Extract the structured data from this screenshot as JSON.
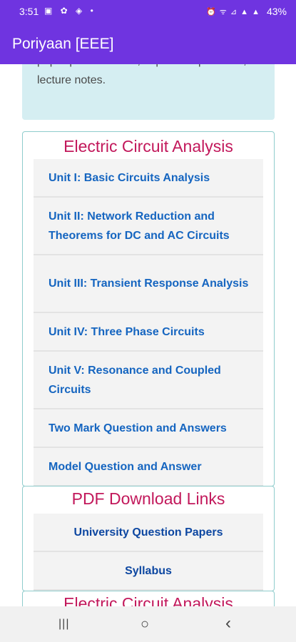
{
  "status": {
    "time": "3:51",
    "left_icons": "▣ ✿ ◈ •",
    "right_icons": "⏰ ᯤ ⊿ ▲ ▲",
    "battery": "43%"
  },
  "app_bar": {
    "title": "Poriyaan [EEE]"
  },
  "intro": {
    "text": "paper pdf download, important questions, lecture notes."
  },
  "section1": {
    "title": "Electric Circuit Analysis",
    "links": [
      "Unit I: Basic Circuits Analysis",
      "Unit II: Network Reduction and Theorems for DC and AC Circuits",
      "Unit III: Transient Response Analysis",
      "Unit IV: Three Phase Circuits",
      "Unit V: Resonance and Coupled Circuits",
      "Two Mark Question and Answers",
      "Model Question and Answer"
    ]
  },
  "section2": {
    "title": "PDF Download Links",
    "links": [
      "University Question Papers",
      "Syllabus"
    ]
  },
  "section3": {
    "title": "Electric Circuit Analysis"
  },
  "nav": {
    "recents": "|||",
    "home": "○",
    "back": "‹"
  }
}
